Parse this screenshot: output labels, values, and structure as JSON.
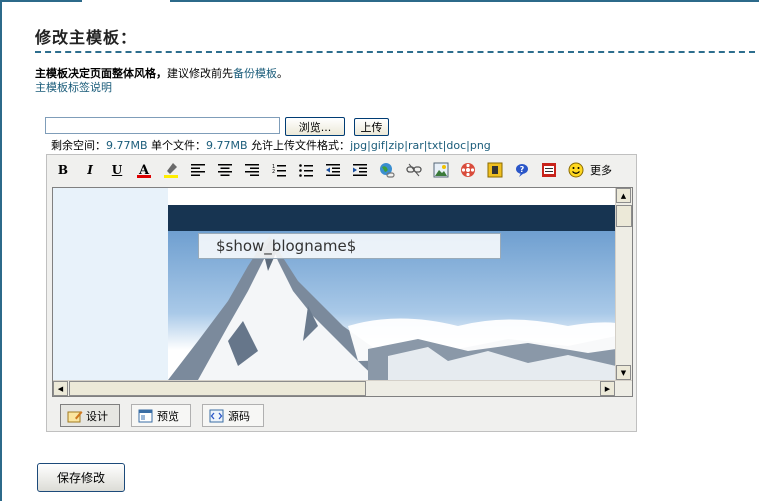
{
  "page": {
    "title": "修改主模板：",
    "notice_bold": "主模板决定页面整体风格，",
    "notice_text": "建议修改前先",
    "notice_link": "备份模板",
    "notice_end": "。",
    "help_link": "主模板标签说明"
  },
  "upload": {
    "file_value": "",
    "browse_label": "浏览...",
    "upload_label": "上传",
    "space_label": "剩余空间：",
    "space_value": "9.77MB",
    "single_label": " 单个文件：",
    "single_value": "9.77MB",
    "allow_label": "  允许上传文件格式：",
    "formats": [
      "jpg",
      "gif",
      "zip",
      "rar",
      "txt",
      "doc",
      "png"
    ]
  },
  "toolbar": {
    "bold": "B",
    "italic": "I",
    "underline": "U",
    "font_color": "A",
    "more_label": "更多"
  },
  "editor": {
    "blogname_placeholder": "$show_blogname$"
  },
  "modes": {
    "design": "设计",
    "preview": "预览",
    "source": "源码"
  },
  "actions": {
    "save": "保存修改"
  },
  "colors": {
    "accent": "#2d6e8e",
    "link": "#1a5c7a",
    "banner": "#173451"
  }
}
